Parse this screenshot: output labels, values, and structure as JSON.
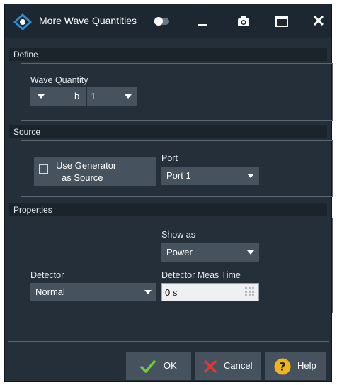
{
  "title_bar": {
    "title": "More Wave Quantities",
    "icons": [
      "rs-logo-icon",
      "toggle-icon",
      "minimize-icon",
      "camera-icon",
      "maximize-icon",
      "close-icon"
    ]
  },
  "define": {
    "header": "Define",
    "wave_quantity_label": "Wave Quantity",
    "wave_dropdown_value": "b",
    "port_dropdown_value": "1"
  },
  "source": {
    "header": "Source",
    "use_generator_line1": "Use Generator",
    "use_generator_line2": "as Source",
    "use_generator_checked": false,
    "port_label": "Port",
    "port_value": "Port 1"
  },
  "properties": {
    "header": "Properties",
    "show_as_label": "Show as",
    "show_as_value": "Power",
    "detector_label": "Detector",
    "detector_value": "Normal",
    "meas_time_label": "Detector Meas Time",
    "meas_time_value": "0 s"
  },
  "buttons": {
    "ok": "OK",
    "cancel": "Cancel",
    "help": "Help"
  },
  "colors": {
    "dialog_bg": "#242f3a",
    "control_bg": "#46535f",
    "ok_check": "#6fcf2f",
    "cancel_x": "#e8332e",
    "help_circle": "#f2b418"
  }
}
